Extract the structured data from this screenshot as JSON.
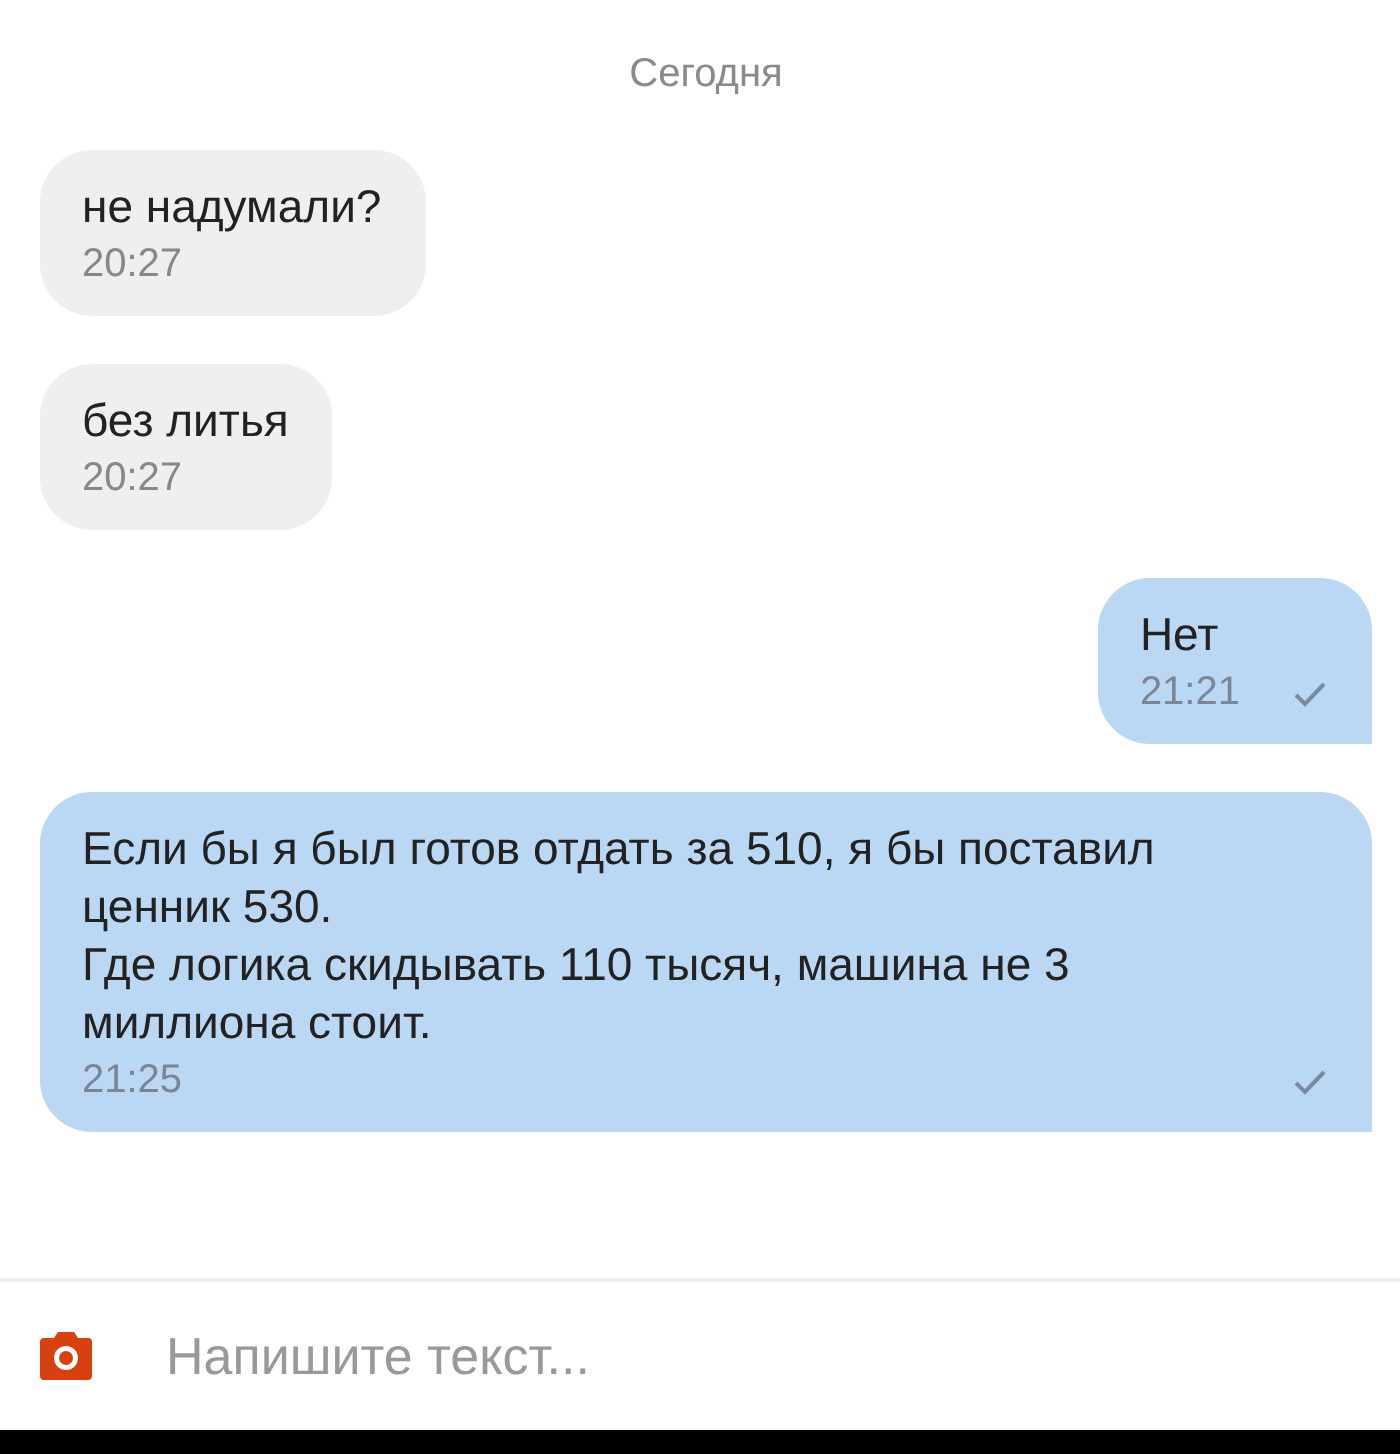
{
  "date_divider": "Сегодня",
  "messages": [
    {
      "kind": "incoming",
      "text": "не надумали?",
      "time": "20:27",
      "sent": false
    },
    {
      "kind": "incoming",
      "text": "без литья",
      "time": "20:27",
      "sent": false
    },
    {
      "kind": "outgoing",
      "text": "Нет",
      "time": "21:21",
      "sent": true
    },
    {
      "kind": "outgoing",
      "text": "Если бы я был готов отдать за 510, я бы поставил\nценник 530.\nГде логика скидывать 110 тысяч, машина не 3\nмиллиона стоит.",
      "time": "21:25",
      "sent": true
    }
  ],
  "composer": {
    "placeholder": "Напишите текст..."
  }
}
